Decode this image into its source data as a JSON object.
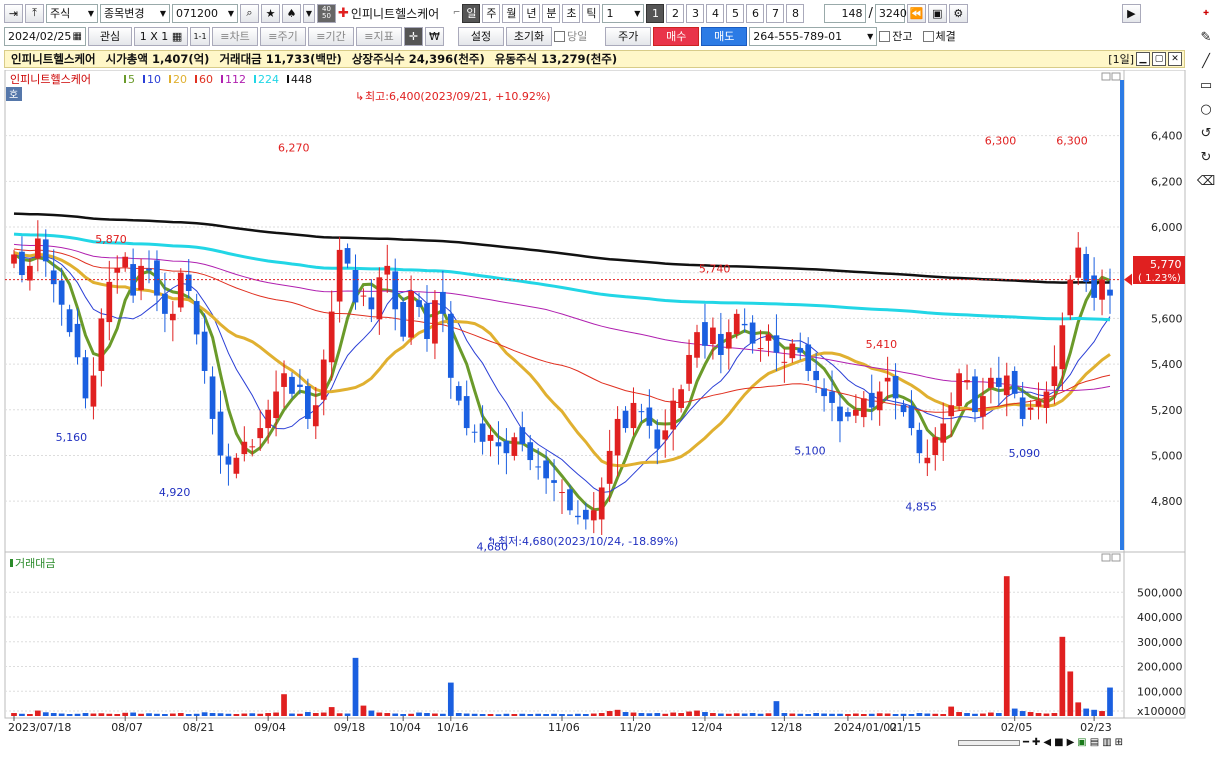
{
  "toolbar1": {
    "market": "주식",
    "change": "종목변경",
    "code": "071200",
    "stock_name": "인피니트헬스케어",
    "period_tabs": [
      "일",
      "주",
      "월",
      "년",
      "분",
      "초",
      "틱"
    ],
    "period_count": "1",
    "num_tabs": [
      "1",
      "2",
      "3",
      "4",
      "5",
      "6",
      "7",
      "8"
    ],
    "count": "148",
    "slash": "/",
    "total": "3240",
    "u_label": "U"
  },
  "toolbar2": {
    "date": "2024/02/25",
    "watch": "관심",
    "grid": "1 X 1",
    "grid_small": "1-1",
    "ref_chart": "≡차트",
    "ref_period": "≡주기",
    "ref_term": "≡기간",
    "ref_index": "≡지표",
    "setup": "설정",
    "reset": "초기화",
    "today": "당일",
    "price": "주가",
    "buy": "매수",
    "sell": "매도",
    "account": "264-555-789-01",
    "balance": "잔고",
    "fill": "체결"
  },
  "info": {
    "name": "인피니트헬스케어",
    "market_cap": "시가총액 1,407(억)",
    "trade_value": "거래대금 11,733(백만)",
    "listed": "상장주식수 24,396(천주)",
    "float": "유동주식 13,279(천주)",
    "interval": "[1일]"
  },
  "legend": {
    "name": "인피니트헬스케어",
    "items": [
      {
        "label": "5",
        "color": "#6a9a2a"
      },
      {
        "label": "10",
        "color": "#2b3fd6"
      },
      {
        "label": "20",
        "color": "#e0b030"
      },
      {
        "label": "60",
        "color": "#e03020"
      },
      {
        "label": "112",
        "color": "#b020b0"
      },
      {
        "label": "224",
        "color": "#22d6e6"
      },
      {
        "label": "448",
        "color": "#111111"
      }
    ],
    "ho": "호"
  },
  "annotations": {
    "high": "최고:6,400(2023/09/21, +10.92%)",
    "low": "최저:4,680(2023/10/24, -18.89%)",
    "labels": [
      {
        "text": "5,870",
        "x": 12,
        "y": 5870,
        "color": "#e02020",
        "pos": "above"
      },
      {
        "text": "5,160",
        "x": 7,
        "y": 5160,
        "color": "#2030c0",
        "pos": "below"
      },
      {
        "text": "4,920",
        "x": 20,
        "y": 4920,
        "color": "#2030c0",
        "pos": "below"
      },
      {
        "text": "6,270",
        "x": 35,
        "y": 6270,
        "color": "#e02020",
        "pos": "above"
      },
      {
        "text": "4,680",
        "x": 60,
        "y": 4680,
        "color": "#2030c0",
        "pos": "below"
      },
      {
        "text": "5,740",
        "x": 88,
        "y": 5740,
        "color": "#e02020",
        "pos": "above"
      },
      {
        "text": "5,100",
        "x": 100,
        "y": 5100,
        "color": "#2030c0",
        "pos": "below"
      },
      {
        "text": "5,410",
        "x": 109,
        "y": 5410,
        "color": "#e02020",
        "pos": "above"
      },
      {
        "text": "4,855",
        "x": 114,
        "y": 4855,
        "color": "#2030c0",
        "pos": "below"
      },
      {
        "text": "6,300",
        "x": 124,
        "y": 6300,
        "color": "#e02020",
        "pos": "above"
      },
      {
        "text": "5,090",
        "x": 127,
        "y": 5090,
        "color": "#2030c0",
        "pos": "below"
      },
      {
        "text": "6,300",
        "x": 133,
        "y": 6300,
        "color": "#e02020",
        "pos": "above"
      }
    ]
  },
  "current_price": {
    "value": "5,770",
    "change": "( 1.23%)",
    "price": 5770
  },
  "volume_label": "거래대금",
  "chart_data": {
    "type": "candlestick",
    "price_ticks": [
      "6,400",
      "6,200",
      "6,000",
      "5,800",
      "5,600",
      "5,400",
      "5,200",
      "5,000",
      "4,800"
    ],
    "price_tick_values": [
      6400,
      6200,
      6000,
      5800,
      5600,
      5400,
      5200,
      5000,
      4800
    ],
    "ylim": [
      4630,
      6600
    ],
    "volume_ticks": [
      "500,000",
      "400,000",
      "300,000",
      "200,000",
      "100,000",
      "x100000"
    ],
    "volume_tick_values": [
      500000,
      400000,
      300000,
      200000,
      100000,
      20000
    ],
    "vlim": [
      0,
      590000
    ],
    "x_labels": [
      {
        "text": "2023/07/18",
        "i": 0
      },
      {
        "text": "08/07",
        "i": 14
      },
      {
        "text": "08/21",
        "i": 23
      },
      {
        "text": "09/04",
        "i": 32
      },
      {
        "text": "09/18",
        "i": 42
      },
      {
        "text": "10/04",
        "i": 49
      },
      {
        "text": "10/16",
        "i": 55
      },
      {
        "text": "11/06",
        "i": 69
      },
      {
        "text": "11/20",
        "i": 78
      },
      {
        "text": "12/04",
        "i": 87
      },
      {
        "text": "12/18",
        "i": 97
      },
      {
        "text": "2024/01/02",
        "i": 105
      },
      {
        "text": "01/15",
        "i": 112
      },
      {
        "text": "02/05",
        "i": 126
      },
      {
        "text": "02/23",
        "i": 136
      }
    ],
    "close": [
      5880,
      5790,
      5830,
      5950,
      5850,
      5750,
      5660,
      5540,
      5430,
      5250,
      5350,
      5600,
      5760,
      5820,
      5870,
      5700,
      5830,
      5810,
      5700,
      5620,
      5620,
      5800,
      5720,
      5530,
      5370,
      5160,
      5000,
      4960,
      4990,
      5060,
      5040,
      5120,
      5200,
      5280,
      5360,
      5270,
      5300,
      5160,
      5220,
      5420,
      5630,
      5900,
      5840,
      5670,
      5700,
      5640,
      5780,
      5830,
      5640,
      5520,
      5720,
      5650,
      5510,
      5680,
      5620,
      5340,
      5240,
      5120,
      5100,
      5060,
      5090,
      5040,
      5010,
      5080,
      5050,
      4980,
      4950,
      4900,
      4880,
      4840,
      4760,
      4730,
      4720,
      4760,
      4860,
      5020,
      5160,
      5120,
      5230,
      5190,
      5130,
      5030,
      5110,
      5240,
      5290,
      5440,
      5540,
      5480,
      5560,
      5440,
      5540,
      5620,
      5570,
      5490,
      5470,
      5530,
      5450,
      5410,
      5490,
      5450,
      5370,
      5330,
      5260,
      5230,
      5150,
      5170,
      5200,
      5250,
      5210,
      5280,
      5340,
      5250,
      5190,
      5120,
      5010,
      4990,
      5080,
      5140,
      5220,
      5360,
      5330,
      5190,
      5260,
      5340,
      5300,
      5350,
      5270,
      5160,
      5210,
      5240,
      5280,
      5390,
      5570,
      5770,
      5910,
      5760,
      5690,
      5770,
      5700
    ],
    "volume": [
      12000,
      9000,
      8000,
      22000,
      15000,
      12000,
      10000,
      8000,
      9000,
      12000,
      10000,
      11000,
      9000,
      8000,
      13000,
      14000,
      9000,
      11000,
      9000,
      8000,
      10000,
      12000,
      8000,
      9000,
      15000,
      12000,
      11000,
      9000,
      8000,
      10000,
      11000,
      9000,
      12000,
      14000,
      88000,
      10000,
      9000,
      16000,
      12000,
      14000,
      36000,
      11000,
      10000,
      235000,
      42000,
      22000,
      14000,
      12000,
      10000,
      8000,
      9000,
      14000,
      12000,
      10000,
      9000,
      135000,
      12000,
      10000,
      9000,
      8000,
      8000,
      7000,
      9000,
      8000,
      9000,
      8000,
      9000,
      8000,
      9000,
      8000,
      7000,
      9000,
      8000,
      10000,
      12000,
      20000,
      25000,
      16000,
      14000,
      12000,
      11000,
      12000,
      9000,
      14000,
      12000,
      18000,
      22000,
      16000,
      12000,
      10000,
      9000,
      11000,
      10000,
      12000,
      9000,
      11000,
      60000,
      12000,
      10000,
      9000,
      8000,
      12000,
      10000,
      9000,
      9000,
      8000,
      10000,
      8000,
      9000,
      11000,
      10000,
      8000,
      9000,
      8000,
      12000,
      10000,
      9000,
      8000,
      38000,
      16000,
      12000,
      9000,
      10000,
      14000,
      12000,
      565000,
      30000,
      20000,
      16000,
      12000,
      10000,
      12000,
      320000,
      180000,
      55000,
      30000,
      25000,
      20000,
      115000
    ]
  }
}
